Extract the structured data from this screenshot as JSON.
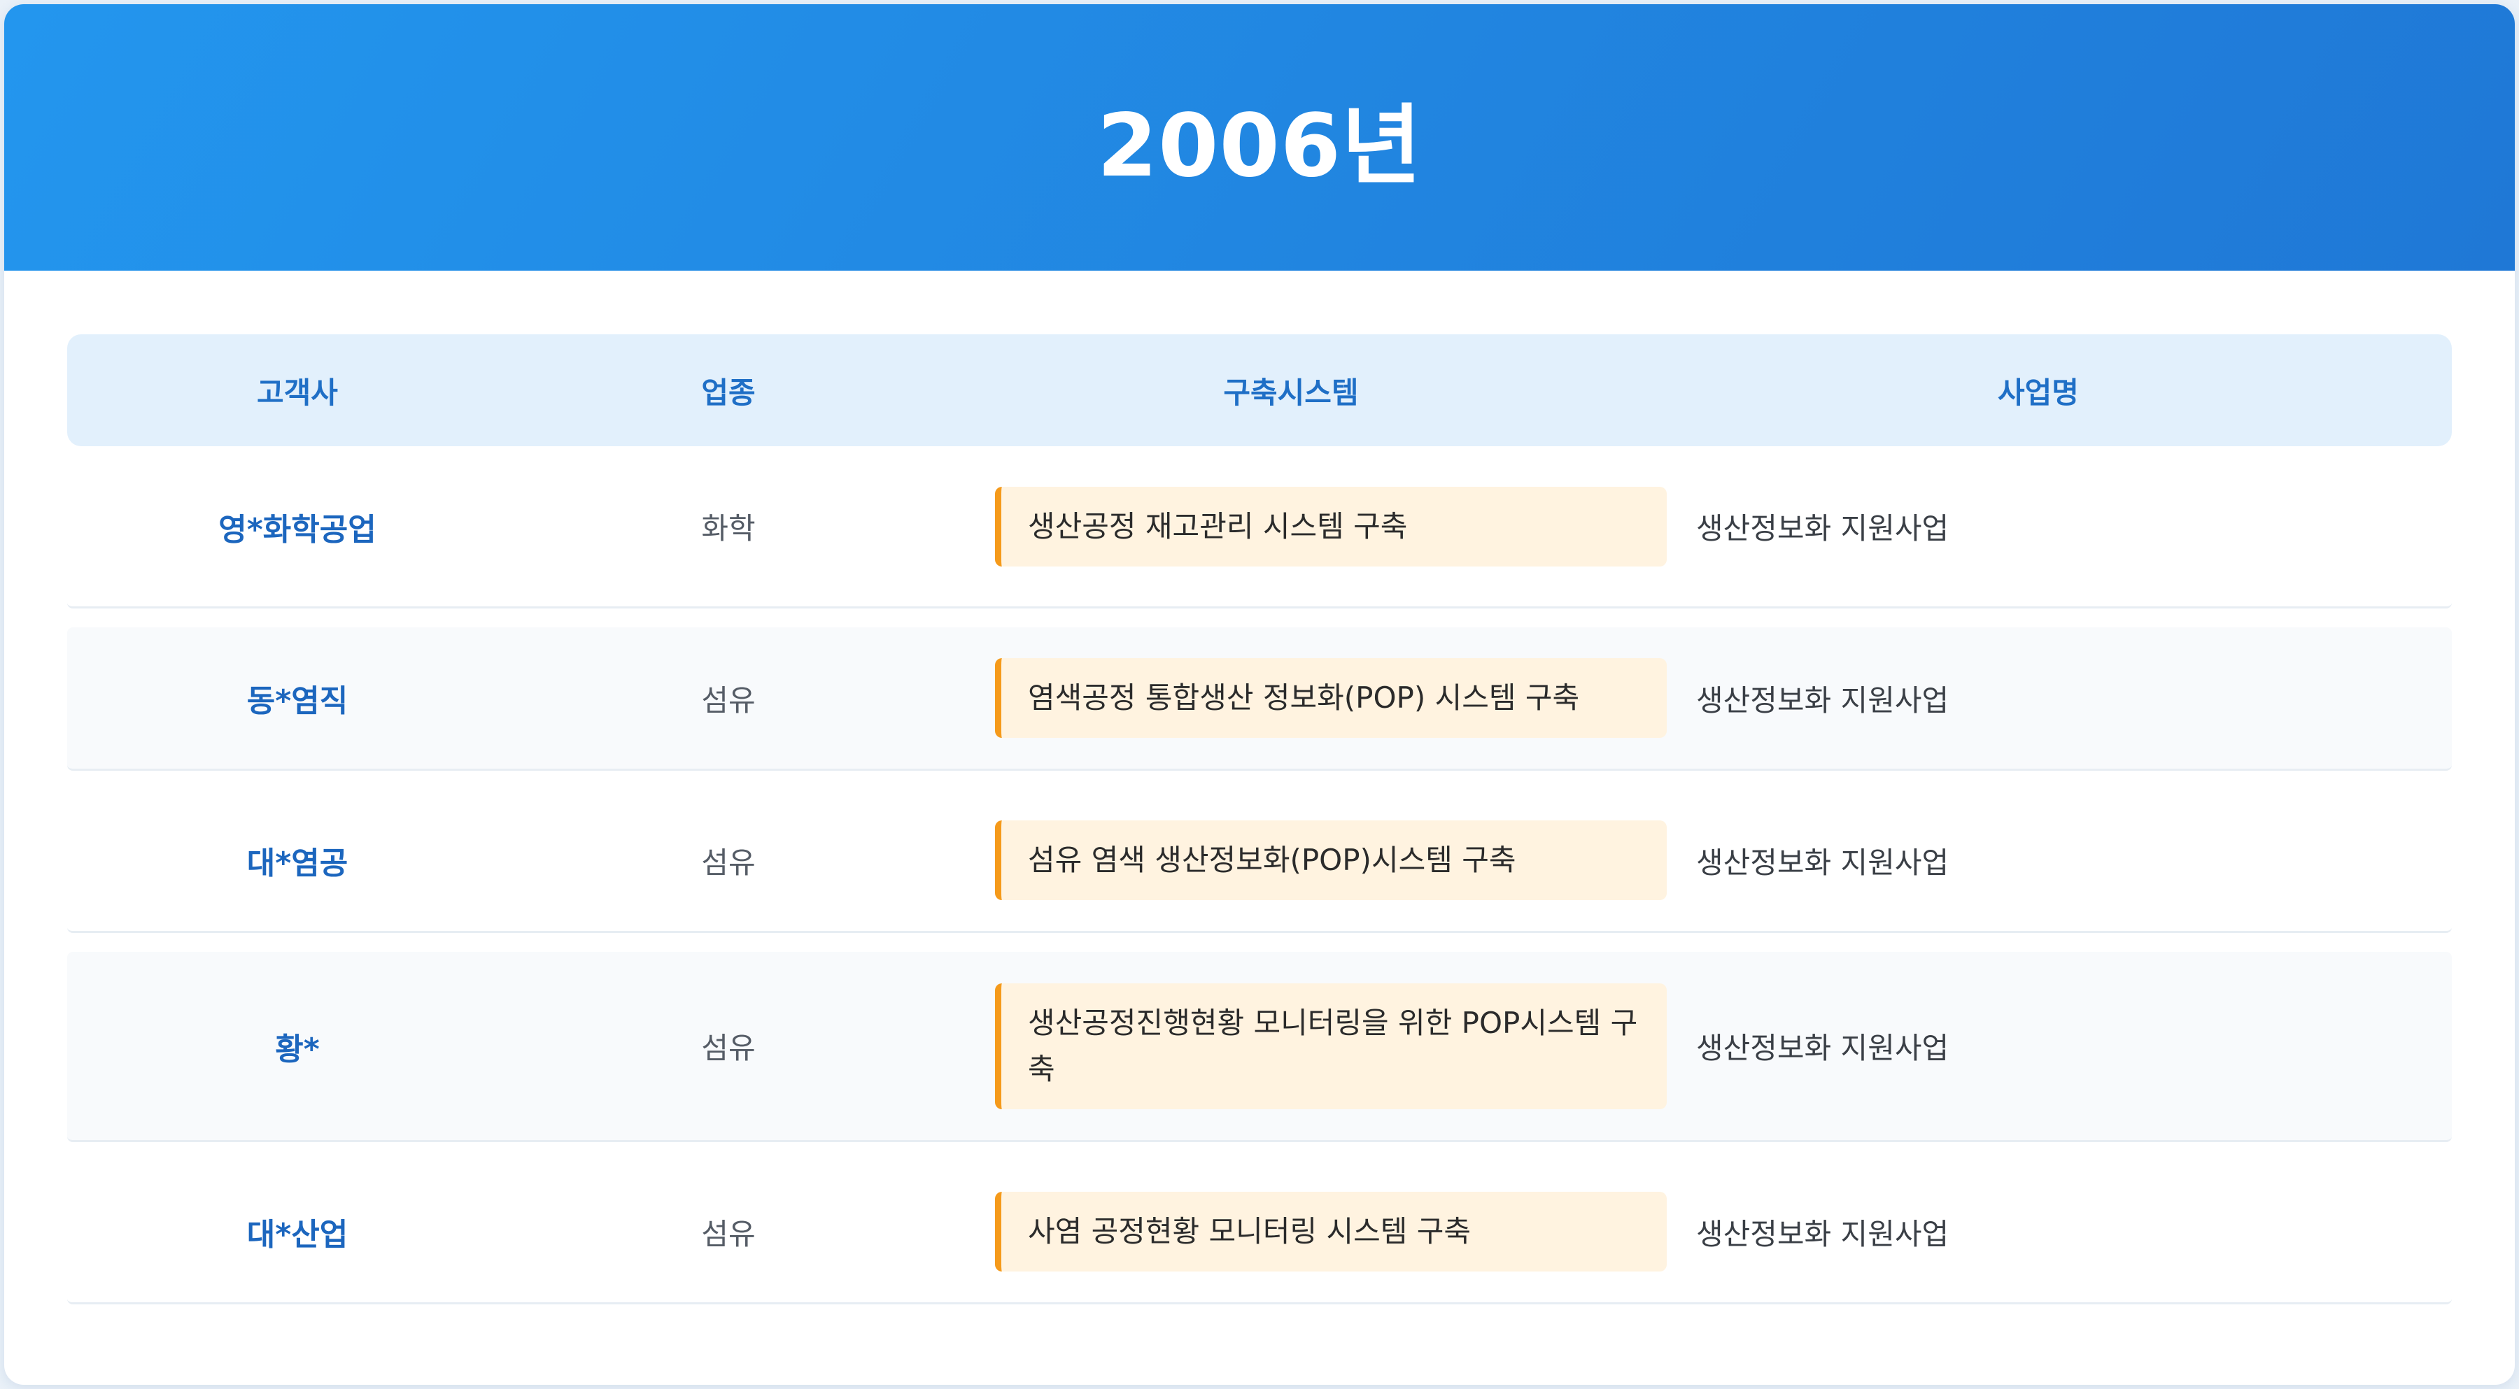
{
  "header": {
    "title": "2006년"
  },
  "table": {
    "columns": {
      "client": "고객사",
      "industry": "업종",
      "system": "구축시스템",
      "project": "사업명"
    },
    "rows": [
      {
        "client": "영*화학공업",
        "industry": "화학",
        "system": "생산공정 재고관리 시스템 구축",
        "project": "생산정보화 지원사업"
      },
      {
        "client": "동*염직",
        "industry": "섬유",
        "system": "염색공정 통합생산 정보화(POP) 시스템 구축",
        "project": "생산정보화 지원사업"
      },
      {
        "client": "대*염공",
        "industry": "섬유",
        "system": "섬유 염색 생산정보화(POP)시스템 구축",
        "project": "생산정보화 지원사업"
      },
      {
        "client": "황*",
        "industry": "섬유",
        "system": "생산공정진행현황 모니터링을 위한 POP시스템 구축",
        "project": "생산정보화 지원사업"
      },
      {
        "client": "대*산업",
        "industry": "섬유",
        "system": "사염 공정현황 모니터링 시스템 구축",
        "project": "생산정보화 지원사업"
      }
    ]
  },
  "colors": {
    "header_bg": "#2185e0",
    "accent_blue": "#1c66be",
    "system_bg": "#fff3e0",
    "system_border": "#f59a1b"
  }
}
